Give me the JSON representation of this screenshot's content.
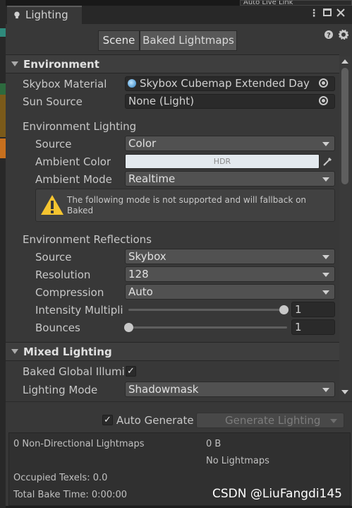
{
  "window": {
    "title": "Lighting",
    "bg_partial_label": "Auto Live Link"
  },
  "toolbar": {
    "tabs": [
      "Scene",
      "Baked Lightmaps"
    ],
    "active_tab": "Scene"
  },
  "environment": {
    "header": "Environment",
    "skybox_material": {
      "label": "Skybox Material",
      "value": "Skybox Cubemap Extended Day"
    },
    "sun_source": {
      "label": "Sun Source",
      "value": "None (Light)"
    },
    "lighting": {
      "header": "Environment Lighting",
      "source": {
        "label": "Source",
        "value": "Color"
      },
      "ambient_color": {
        "label": "Ambient Color",
        "value": "HDR"
      },
      "ambient_mode": {
        "label": "Ambient Mode",
        "value": "Realtime"
      },
      "warning": "The following mode is not supported and will fallback on Baked"
    },
    "reflections": {
      "header": "Environment Reflections",
      "source": {
        "label": "Source",
        "value": "Skybox"
      },
      "resolution": {
        "label": "Resolution",
        "value": "128"
      },
      "compression": {
        "label": "Compression",
        "value": "Auto"
      },
      "intensity": {
        "label": "Intensity Multiplie",
        "value": "1",
        "level": 1.0
      },
      "bounces": {
        "label": "Bounces",
        "value": "1",
        "level": 0.0
      }
    }
  },
  "mixed": {
    "header": "Mixed Lighting",
    "baked_gi": {
      "label": "Baked Global Illumir",
      "checked": true
    },
    "lighting_mode": {
      "label": "Lighting Mode",
      "value": "Shadowmask"
    }
  },
  "footer": {
    "auto_generate": {
      "label": "Auto Generate",
      "checked": true
    },
    "generate_button": "Generate Lighting"
  },
  "stats": {
    "lightmaps": "0 Non-Directional Lightmaps",
    "size": "0 B",
    "no_lightmaps": "No Lightmaps",
    "occupied": "Occupied Texels: 0.0",
    "bake_time": "Total Bake Time: 0:00:00"
  },
  "watermark": "CSDN @LiuFangdi145",
  "colors": {
    "panel": "#383838",
    "field": "#2a2a2a",
    "dropdown": "#515151",
    "ambient_swatch": "#e3e9ee",
    "warning_icon": "#f4c430"
  },
  "icons": [
    "lightbulb-icon",
    "kebab-menu-icon",
    "maximize-icon",
    "close-icon",
    "help-icon",
    "settings-icon",
    "object-picker-icon",
    "eyedropper-icon",
    "warning-icon",
    "checkmark-icon"
  ]
}
